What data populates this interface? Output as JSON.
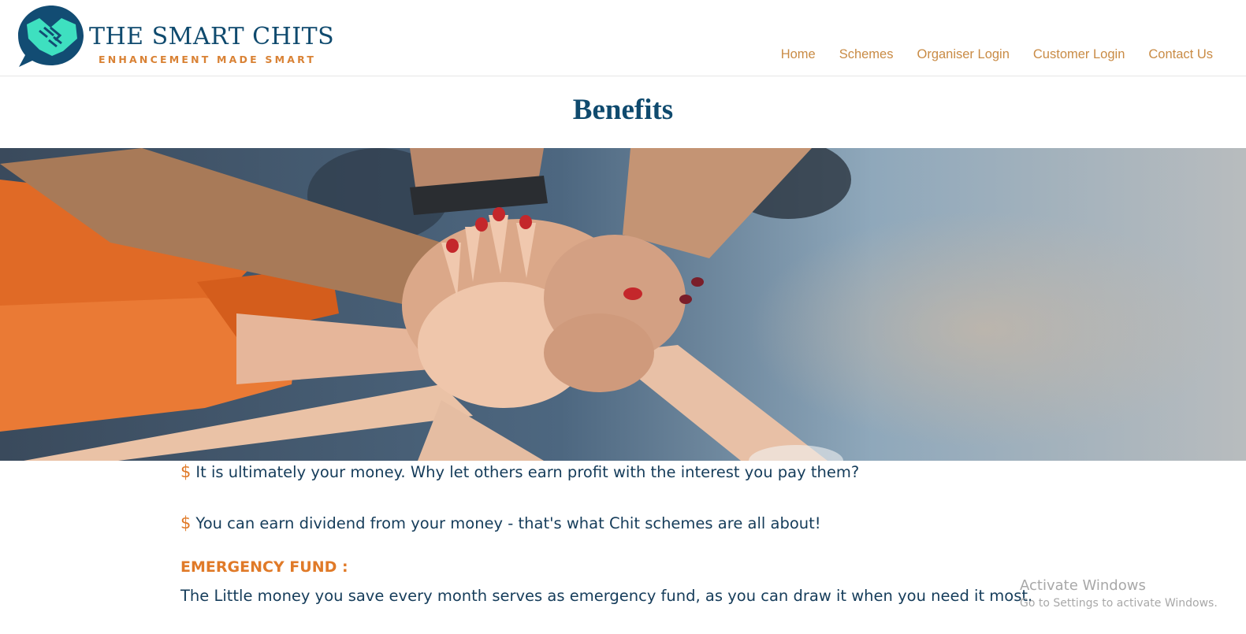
{
  "brand": {
    "name": "THE SMART CHITS",
    "tagline": "ENHANCEMENT MADE SMART",
    "colors": {
      "primary": "#0f4a6e",
      "accent": "#d98235",
      "teal": "#3ee0c0"
    }
  },
  "nav": {
    "items": [
      {
        "label": "Home"
      },
      {
        "label": "Schemes"
      },
      {
        "label": "Organiser Login"
      },
      {
        "label": "Customer Login"
      },
      {
        "label": "Contact Us"
      }
    ]
  },
  "page": {
    "title": "Benefits"
  },
  "hero": {
    "icon": "team-hands-stacked-image"
  },
  "benefits": {
    "bullet_symbol": "$",
    "items": [
      {
        "text": "It is ultimately your money. Why let others earn profit with the interest you pay them?"
      },
      {
        "text": "You can earn dividend from your money - that's what Chit schemes are all about!"
      }
    ],
    "emergency": {
      "heading": "EMERGENCY FUND :",
      "text": "The Little money you save every month serves as emergency fund, as you can draw it when you need it most."
    }
  },
  "watermark": {
    "title": "Activate Windows",
    "subtitle": "Go to Settings to activate Windows."
  }
}
